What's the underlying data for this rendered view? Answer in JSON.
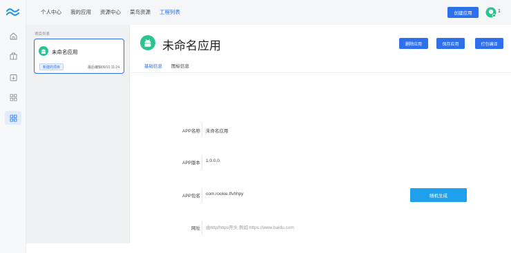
{
  "topnav": {
    "tabs": [
      {
        "label": "个人中心"
      },
      {
        "label": "我的应用"
      },
      {
        "label": "资源中心"
      },
      {
        "label": "菜鸟资源"
      },
      {
        "label": "工程列表"
      }
    ],
    "active_index": 4,
    "create_label": "创建应用",
    "avatar_count": "1"
  },
  "rail": {
    "icons": [
      "logo-icon",
      "home-icon",
      "building-icon",
      "download-box-icon",
      "grid-icon",
      "grid-active-icon"
    ]
  },
  "projects": {
    "title": "项目列表",
    "items": [
      {
        "name": "未命名应用",
        "badge": "新建的项目",
        "time": "最后编辑09/10 11:24"
      }
    ]
  },
  "app": {
    "title": "未命名应用",
    "actions": {
      "delete": "删除应用",
      "save": "保存应用",
      "build": "打包编译"
    },
    "tabs": [
      {
        "label": "基础信息"
      },
      {
        "label": "图标信息"
      }
    ],
    "active_tab": 0
  },
  "form": {
    "name_label": "APP名称",
    "name_value": "未命名应用",
    "version_label": "APP版本",
    "version_value": "1.0.0.0",
    "package_label": "APP包名",
    "package_value": "com.rookie.tfvhhpy",
    "url_label": "网址",
    "url_placeholder": "由http/https开头,例如:https://www.baidu.com",
    "generate_label": "随机生成"
  },
  "colors": {
    "accent": "#2e6fec",
    "generate": "#1fa0ec",
    "android": "#2bc38f"
  }
}
